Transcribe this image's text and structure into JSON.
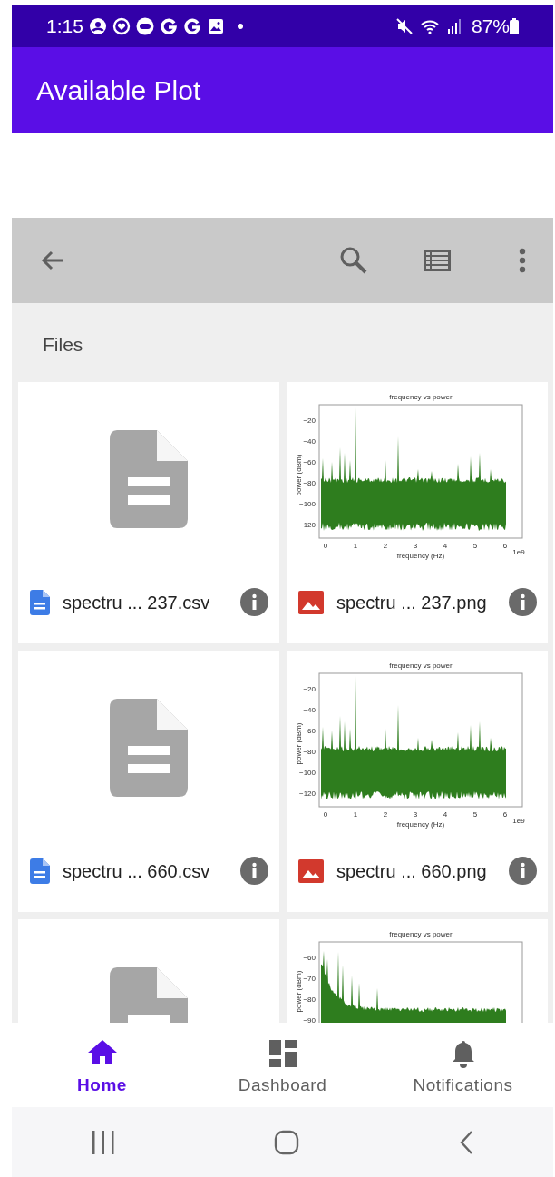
{
  "status_bar": {
    "time": "1:15",
    "battery": "87%"
  },
  "app_bar": {
    "title": "Available Plot"
  },
  "section": {
    "title": "Files"
  },
  "files": [
    {
      "name": "spectru ... 237.csv",
      "kind": "document"
    },
    {
      "name": "spectru ... 237.png",
      "kind": "image",
      "plot": {
        "title": "frequency  vs  power",
        "ylabel": "power (dBm)",
        "yticks": [
          "−20",
          "−40",
          "−60",
          "−80",
          "−100",
          "−120"
        ],
        "xticks": [
          "0",
          "1",
          "2",
          "3",
          "4",
          "5",
          "6"
        ],
        "xlabel": "frequency (Hz)",
        "x_offset": "1e9"
      }
    },
    {
      "name": "spectru ... 660.csv",
      "kind": "document"
    },
    {
      "name": "spectru ... 660.png",
      "kind": "image",
      "plot": {
        "title": "frequency  vs  power",
        "ylabel": "power (dBm)",
        "yticks": [
          "−20",
          "−40",
          "−60",
          "−80",
          "−100",
          "−120"
        ],
        "xticks": [
          "0",
          "1",
          "2",
          "3",
          "4",
          "5",
          "6"
        ],
        "xlabel": "frequency (Hz)",
        "x_offset": "1e9"
      }
    },
    {
      "kind": "document"
    },
    {
      "kind": "image",
      "plot": {
        "title": "frequency  vs  power",
        "ylabel": "power (dBm)",
        "yticks": [
          "−60",
          "−70",
          "−80",
          "−90"
        ]
      }
    }
  ],
  "bottom_nav": [
    {
      "label": "Home",
      "selected": true
    },
    {
      "label": "Dashboard",
      "selected": false
    },
    {
      "label": "Notifications",
      "selected": false
    }
  ]
}
